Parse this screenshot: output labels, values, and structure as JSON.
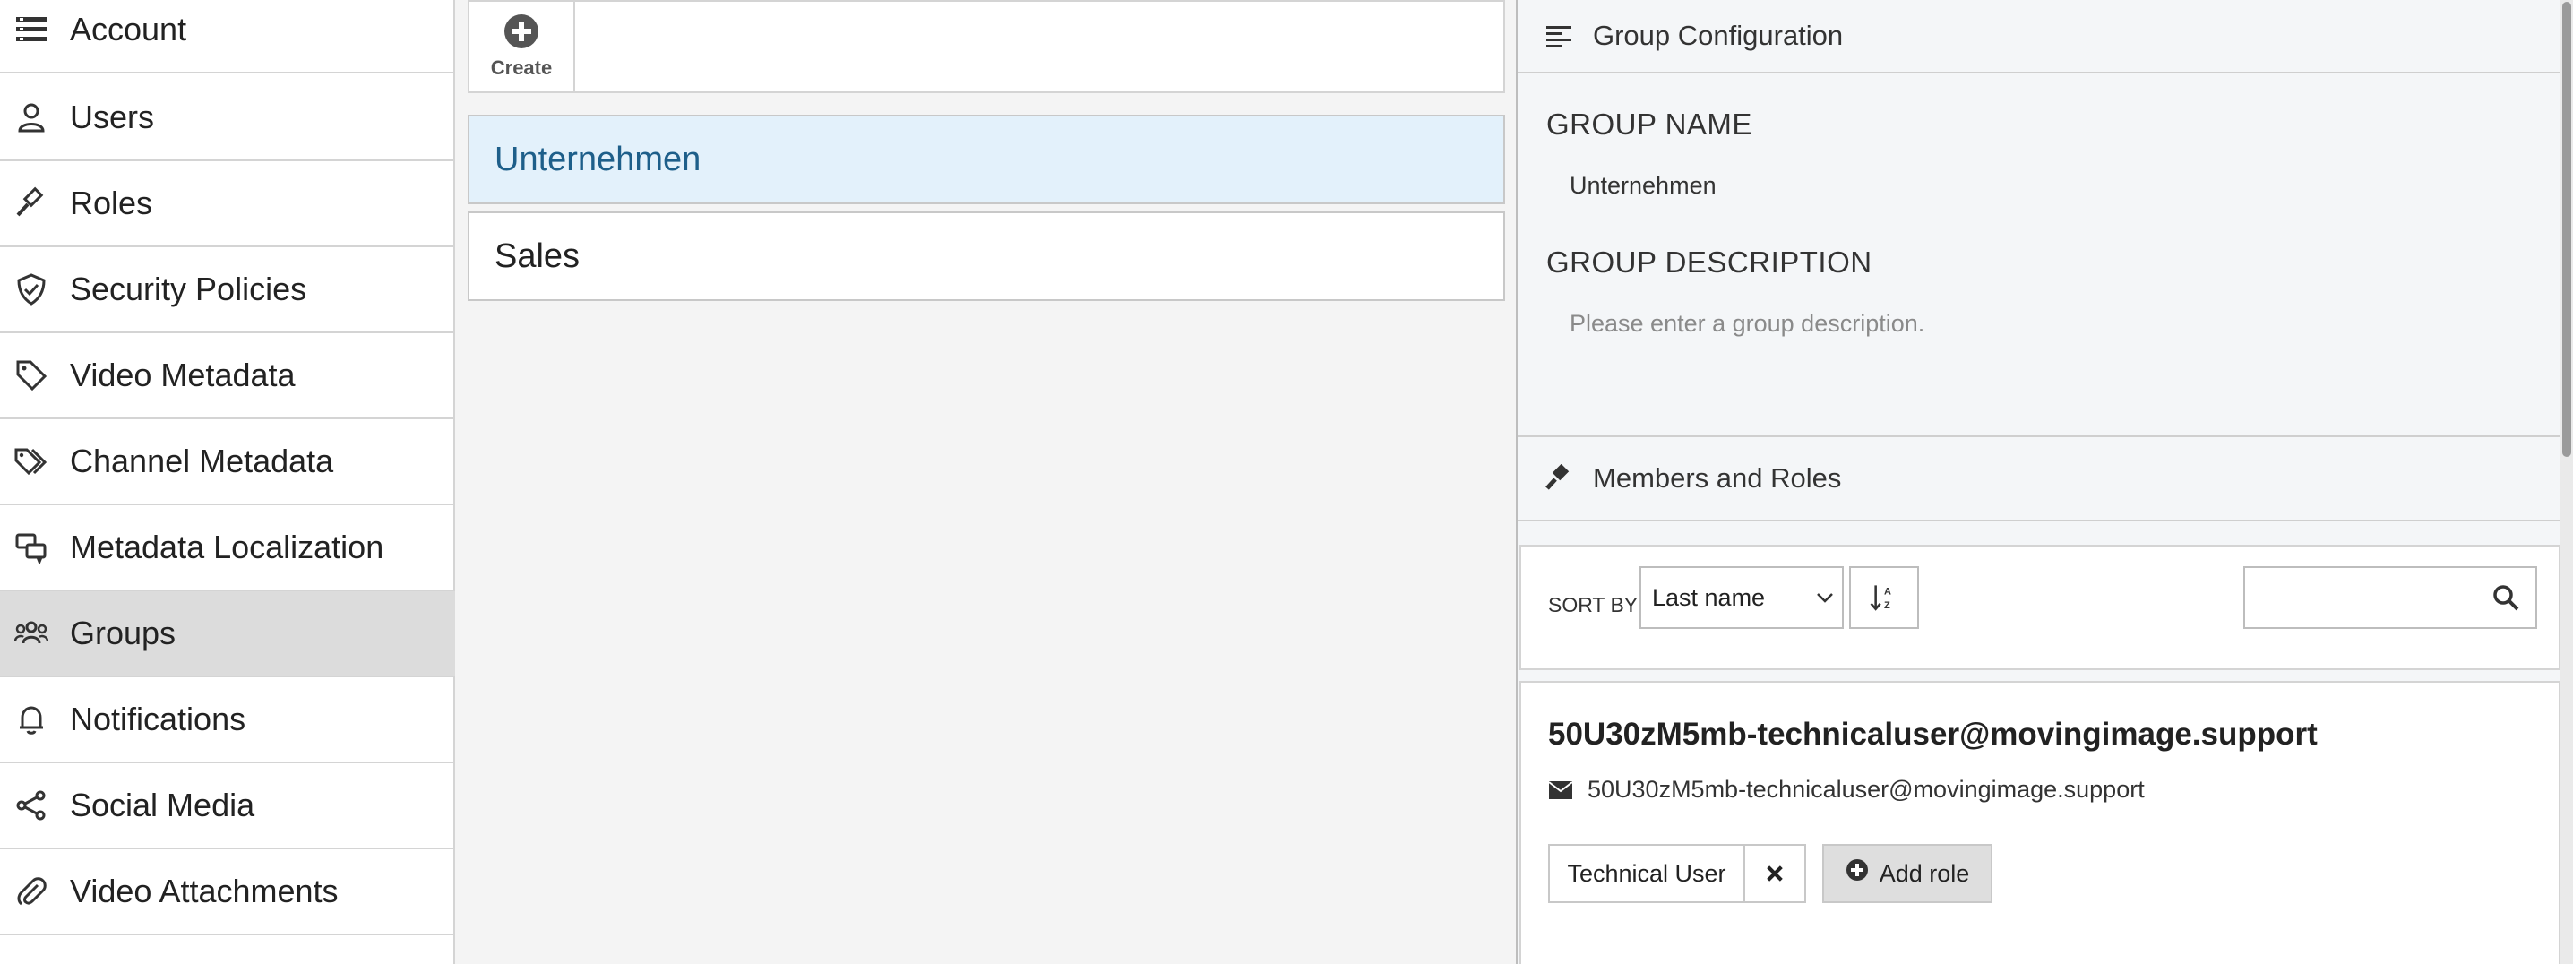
{
  "sidebar": {
    "items": [
      {
        "label": "Account",
        "icon": "account-list-icon",
        "active": false
      },
      {
        "label": "Users",
        "icon": "user-icon",
        "active": false
      },
      {
        "label": "Roles",
        "icon": "gavel-icon",
        "active": false
      },
      {
        "label": "Security Policies",
        "icon": "shield-check-icon",
        "active": false
      },
      {
        "label": "Video Metadata",
        "icon": "tag-icon",
        "active": false
      },
      {
        "label": "Channel Metadata",
        "icon": "tags-icon",
        "active": false
      },
      {
        "label": "Metadata Localization",
        "icon": "speech-bubbles-icon",
        "active": false
      },
      {
        "label": "Groups",
        "icon": "users-group-icon",
        "active": true
      },
      {
        "label": "Notifications",
        "icon": "bell-icon",
        "active": false
      },
      {
        "label": "Social Media",
        "icon": "share-icon",
        "active": false
      },
      {
        "label": "Video Attachments",
        "icon": "paperclip-icon",
        "active": false
      }
    ]
  },
  "toolbar": {
    "create_label": "Create"
  },
  "groups": [
    {
      "name": "Unternehmen",
      "selected": true
    },
    {
      "name": "Sales",
      "selected": false
    }
  ],
  "config": {
    "header": "Group Configuration",
    "name_label": "GROUP NAME",
    "name_value": "Unternehmen",
    "description_label": "GROUP DESCRIPTION",
    "description_placeholder": "Please enter a group description."
  },
  "members": {
    "header": "Members and Roles",
    "sort_label": "SORT BY",
    "sort_value": "Last name",
    "search_placeholder": "",
    "items": [
      {
        "name": "50U30zM5mb-technicaluser@movingimage.support",
        "email": "50U30zM5mb-technicaluser@movingimage.support",
        "role": "Technical User",
        "add_role_label": "Add role"
      }
    ]
  },
  "colors": {
    "selected_bg": "#e3f1fb",
    "selected_text": "#1e5f8a",
    "active_sidebar": "#dcdcdc"
  }
}
